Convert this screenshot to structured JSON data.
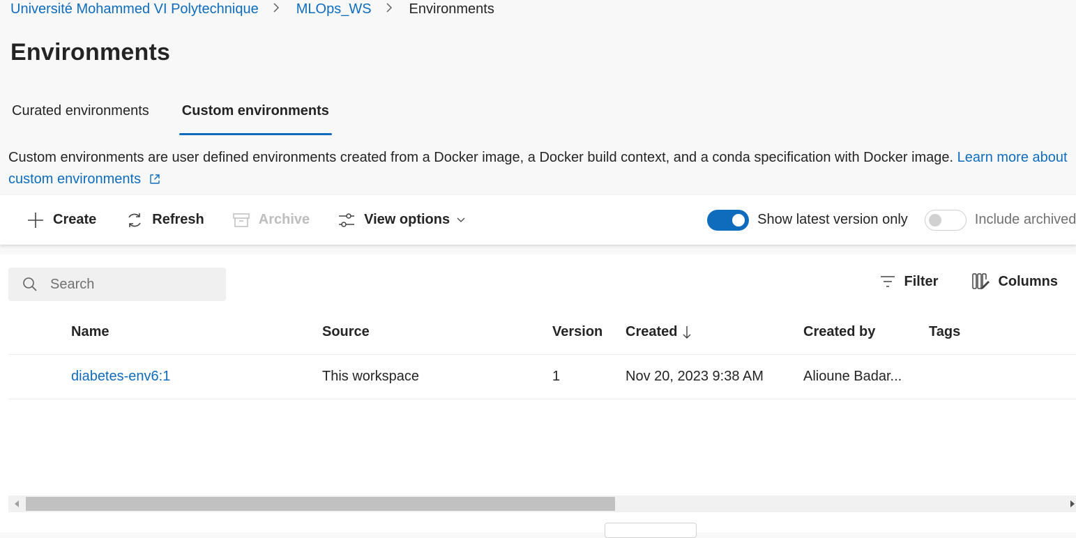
{
  "breadcrumb": {
    "items": [
      "Université Mohammed VI Polytechnique",
      "MLOps_WS"
    ],
    "current": "Environments",
    "separator": ">"
  },
  "page": {
    "title": "Environments"
  },
  "tabs": [
    {
      "label": "Curated environments",
      "active": false
    },
    {
      "label": "Custom environments",
      "active": true
    }
  ],
  "description": {
    "text": "Custom environments are user defined environments created from a Docker image, a Docker build context, and a conda specification with Docker image. ",
    "link": "Learn more about custom environments"
  },
  "toolbar": {
    "create": "Create",
    "refresh": "Refresh",
    "archive": "Archive",
    "view_options": "View options",
    "show_latest": {
      "label": "Show latest version only",
      "on": true
    },
    "include_archived": {
      "label": "Include archived",
      "on": false
    }
  },
  "search": {
    "placeholder": "Search",
    "value": ""
  },
  "list_tools": {
    "filter": "Filter",
    "columns": "Columns"
  },
  "table": {
    "headers": {
      "name": "Name",
      "source": "Source",
      "version": "Version",
      "created": "Created",
      "created_by": "Created by",
      "tags": "Tags"
    },
    "rows": [
      {
        "name": "diabetes-env6:1",
        "source": "This workspace",
        "version": "1",
        "created": "Nov 20, 2023 9:38 AM",
        "created_by": "Alioune Badar...",
        "tags": ""
      }
    ]
  },
  "colors": {
    "accent": "#0f6cbd",
    "text": "#242424",
    "background": "#f8f8f8"
  }
}
